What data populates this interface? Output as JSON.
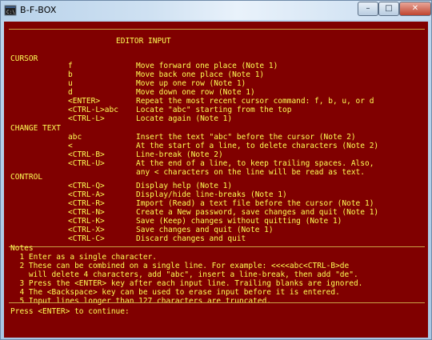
{
  "window": {
    "title": "B-F-BOX",
    "buttons": {
      "minimize": "–",
      "maximize": "□",
      "close": "✕"
    }
  },
  "console": {
    "heading": "EDITOR INPUT",
    "sections": [
      {
        "title": "CURSOR",
        "rows": [
          {
            "key": "f",
            "desc": "Move forward one place (Note 1)"
          },
          {
            "key": "b",
            "desc": "Move back one place (Note 1)"
          },
          {
            "key": "u",
            "desc": "Move up one row (Note 1)"
          },
          {
            "key": "d",
            "desc": "Move down one row (Note 1)"
          },
          {
            "key": "<ENTER>",
            "desc": "Repeat the most recent cursor command: f, b, u, or d"
          },
          {
            "key": "<CTRL-L>abc",
            "desc": "Locate \"abc\" starting from the top"
          },
          {
            "key": "<CTRL-L>",
            "desc": "Locate again (Note 1)"
          }
        ]
      },
      {
        "title": "CHANGE TEXT",
        "rows": [
          {
            "key": "abc",
            "desc": "Insert the text \"abc\" before the cursor (Note 2)"
          },
          {
            "key": "<",
            "desc": "At the start of a line, to delete characters (Note 2)"
          },
          {
            "key": "<CTRL-B>",
            "desc": "Line-break (Note 2)"
          },
          {
            "key": "<CTRL-U>",
            "desc": "At the end of a line, to keep trailing spaces. Also,"
          },
          {
            "key": "",
            "desc": "any < characters on the line will be read as text."
          }
        ]
      },
      {
        "title": "CONTROL",
        "rows": [
          {
            "key": "<CTRL-Q>",
            "desc": "Display help (Note 1)"
          },
          {
            "key": "<CTRL-A>",
            "desc": "Display/hide line-breaks (Note 1)"
          },
          {
            "key": "<CTRL-R>",
            "desc": "Import (Read) a text file before the cursor (Note 1)"
          },
          {
            "key": "<CTRL-N>",
            "desc": "Create a New password, save changes and quit (Note 1)"
          },
          {
            "key": "<CTRL-K>",
            "desc": "Save (Keep) changes without quitting (Note 1)"
          },
          {
            "key": "<CTRL-X>",
            "desc": "Save changes and quit (Note 1)"
          },
          {
            "key": "<CTRL-C>",
            "desc": "Discard changes and quit"
          }
        ]
      }
    ],
    "notes_title": "Notes",
    "notes": [
      "  1 Enter as a single character.",
      "  2 These can be combined on a single line. For example: <<<<abc<CTRL-B>de",
      "    will delete 4 characters, add \"abc\", insert a line-break, then add \"de\".",
      "  3 Press the <ENTER> key after each input line. Trailing blanks are ignored.",
      "  4 The <Backspace> key can be used to erase input before it is entered.",
      "  5 Input lines longer than 127 characters are truncated."
    ],
    "prompt": "Press <ENTER> to continue:"
  }
}
